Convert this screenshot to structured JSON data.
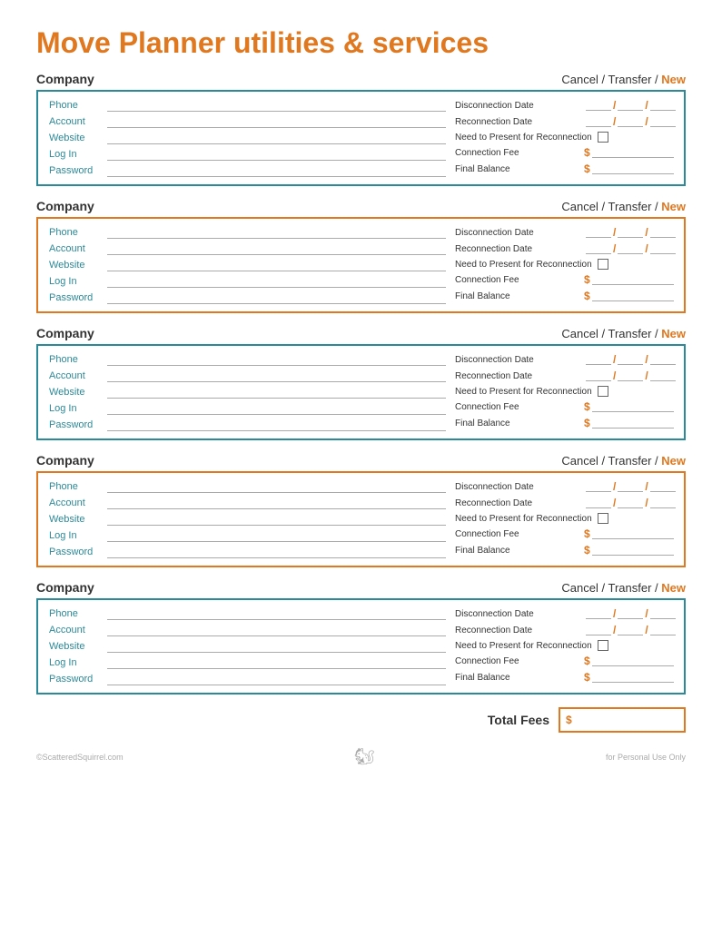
{
  "page": {
    "title_part1": "Move Planner ",
    "title_part2": "utilities & services"
  },
  "sections": [
    {
      "border": "teal",
      "company_label": "Company",
      "cancel_label": "Cancel",
      "slash1": "/",
      "transfer_label": "Transfer",
      "slash2": "/",
      "new_label": "New",
      "fields": {
        "phone": "Phone",
        "account": "Account",
        "website": "Website",
        "login": "Log In",
        "password": "Password"
      },
      "right": {
        "disconnection_date": "Disconnection Date",
        "reconnection_date": "Reconnection Date",
        "need_present": "Need to Present for Reconnection",
        "connection_fee": "Connection Fee",
        "final_balance": "Final Balance"
      }
    },
    {
      "border": "orange",
      "company_label": "Company",
      "cancel_label": "Cancel",
      "slash1": "/",
      "transfer_label": "Transfer",
      "slash2": "/",
      "new_label": "New"
    },
    {
      "border": "teal",
      "company_label": "Company",
      "cancel_label": "Cancel",
      "slash1": "/",
      "transfer_label": "Transfer",
      "slash2": "/",
      "new_label": "New"
    },
    {
      "border": "orange",
      "company_label": "Company",
      "cancel_label": "Cancel",
      "slash1": "/",
      "transfer_label": "Transfer",
      "slash2": "/",
      "new_label": "New"
    },
    {
      "border": "teal",
      "company_label": "Company",
      "cancel_label": "Cancel",
      "slash1": "/",
      "transfer_label": "Transfer",
      "slash2": "/",
      "new_label": "New"
    }
  ],
  "total_fees": {
    "label": "Total Fees",
    "dollar": "$"
  },
  "footer": {
    "left": "©ScatteredSquirrel.com",
    "right": "for Personal Use Only"
  },
  "labels": {
    "phone": "Phone",
    "account": "Account",
    "website": "Website",
    "login": "Log In",
    "password": "Password",
    "disconnection_date": "Disconnection Date",
    "reconnection_date": "Reconnection Date",
    "need_present": "Need to Present for Reconnection",
    "connection_fee": "Connection Fee",
    "final_balance": "Final Balance"
  }
}
